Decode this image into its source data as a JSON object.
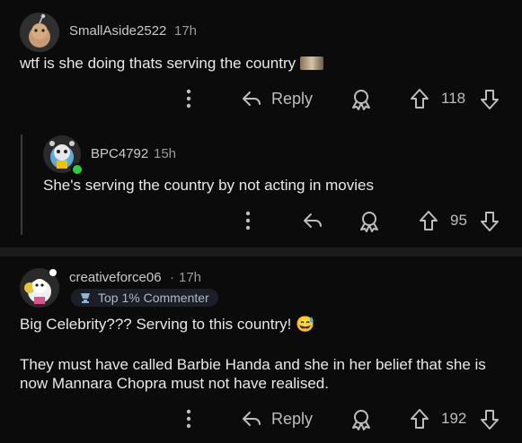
{
  "comments": [
    {
      "username": "SmallAside2522",
      "time": "17h",
      "text": "wtf is she doing thats serving the country",
      "reply_label": "Reply",
      "upvotes": "118"
    },
    {
      "username": "BPC4792",
      "time": "15h",
      "text": "She's serving the country by not acting in movies",
      "upvotes": "95"
    },
    {
      "username": "creativeforce06",
      "separator": "·",
      "time": "17h",
      "badge": "Top 1% Commenter",
      "text_line1": "Big Celebrity??? Serving to this country! 😅",
      "text_para2_line1": "They must have called Barbie Handa and she in her belief that she is",
      "text_para2_line2": "now Mannara Chopra must not have realised.",
      "reply_label": "Reply",
      "upvotes": "192"
    }
  ],
  "colors": {
    "background": "#0b0b0b",
    "text": "#e8e8e8",
    "muted": "#9a9a9a",
    "online": "#2ecc40",
    "badge_bg": "#1c1f27"
  },
  "icons": [
    "more-icon",
    "reply-icon",
    "award-icon",
    "upvote-icon",
    "downvote-icon",
    "online-status-dot"
  ]
}
